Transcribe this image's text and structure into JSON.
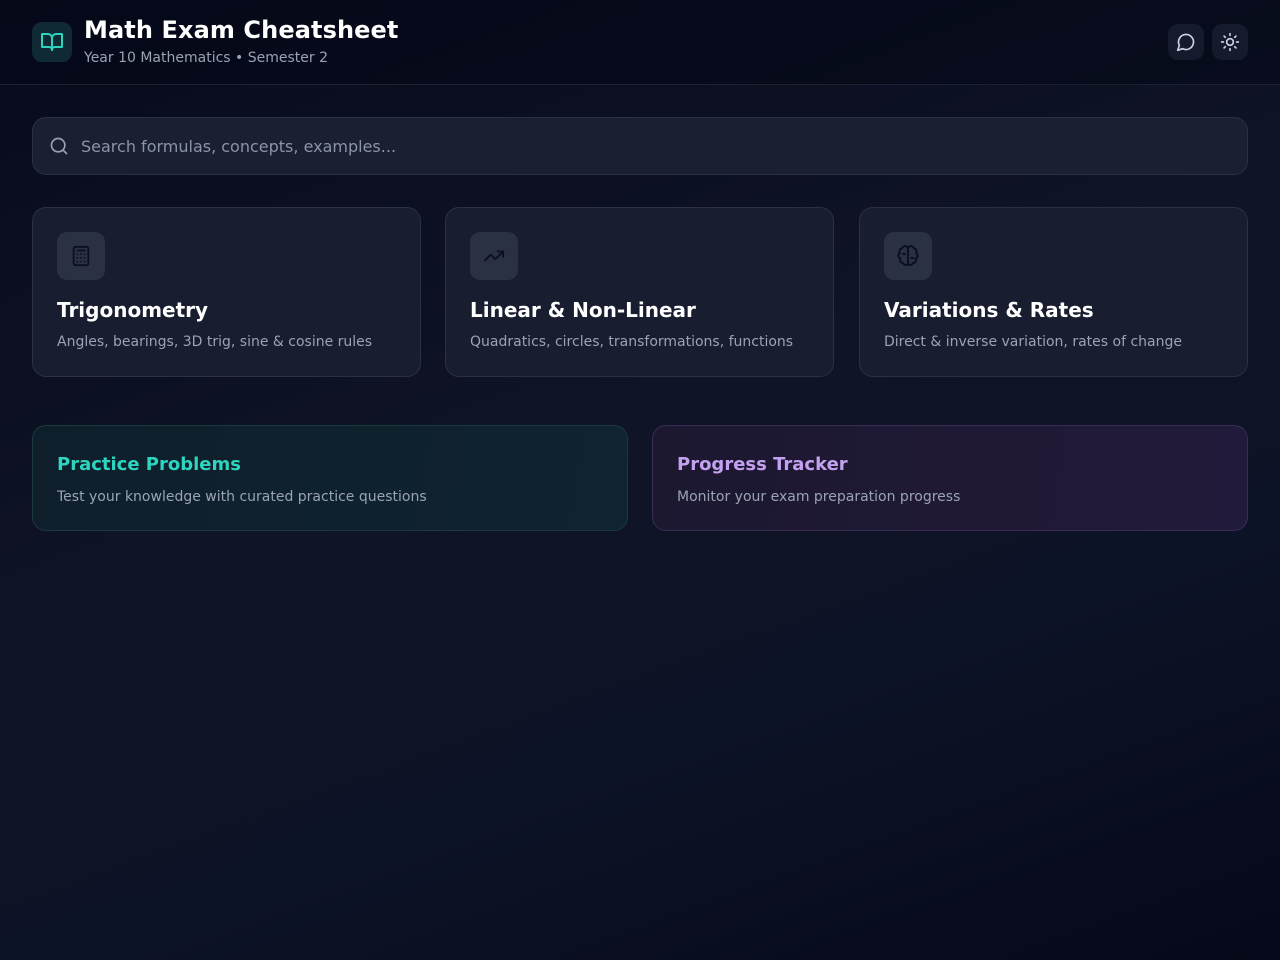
{
  "header": {
    "title": "Math Exam Cheatsheet",
    "subtitle": "Year 10 Mathematics • Semester 2",
    "logo_icon": "book-open-icon",
    "buttons": [
      {
        "icon": "chat-icon"
      },
      {
        "icon": "sun-icon"
      }
    ]
  },
  "search": {
    "placeholder": "Search formulas, concepts, examples...",
    "value": "",
    "icon": "search-icon"
  },
  "topics": [
    {
      "icon": "calculator-icon",
      "title": "Trigonometry",
      "description": "Angles, bearings, 3D trig, sine & cosine rules"
    },
    {
      "icon": "trending-up-icon",
      "title": "Linear & Non-Linear",
      "description": "Quadratics, circles, transformations, functions"
    },
    {
      "icon": "brain-icon",
      "title": "Variations & Rates",
      "description": "Direct & inverse variation, rates of change"
    }
  ],
  "features": [
    {
      "title": "Practice Problems",
      "description": "Test your knowledge with curated practice questions",
      "accent": "#2dd4bf"
    },
    {
      "title": "Progress Tracker",
      "description": "Monitor your exam preparation progress",
      "accent": "#c4a1f0"
    }
  ],
  "colors": {
    "background": "#0b1020",
    "card": "#181d2f",
    "text_muted": "#9aa3b5",
    "teal_accent": "#2dd4bf",
    "purple_accent": "#c4a1f0"
  }
}
